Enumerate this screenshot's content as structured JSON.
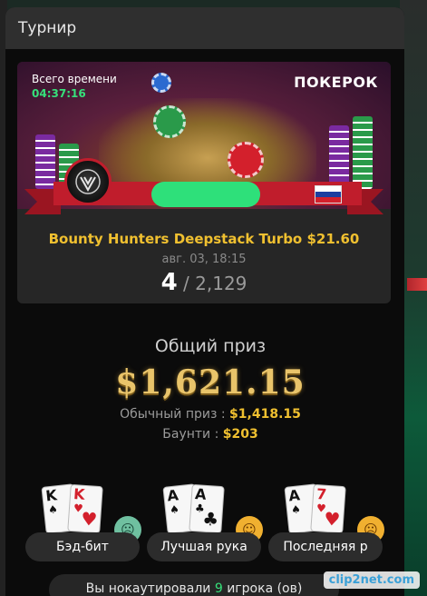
{
  "header": {
    "title": "Турнир"
  },
  "banner": {
    "elapsed_label": "Всего времени",
    "elapsed_time": "04:37:16",
    "logo": "ПОКЕРОК"
  },
  "tournament": {
    "name": "Bounty Hunters Deepstack Turbo $21.60",
    "date": "авг. 03, 18:15",
    "place": "4",
    "place_separator": " / ",
    "entrants": "2,129"
  },
  "prize": {
    "title": "Общий приз",
    "total": "$1,621.15",
    "regular_label": "Обычный приз : ",
    "regular_value": "$1,418.15",
    "bounty_label": "Баунти : ",
    "bounty_value": "$203"
  },
  "awards": [
    {
      "label": "Бэд-бит",
      "cards": [
        {
          "rank": "K",
          "suit": "♠",
          "color": "black"
        },
        {
          "rank": "K",
          "suit": "♥",
          "color": "red"
        }
      ],
      "emoji_icon": "sick-face-icon",
      "emoji_color": "#6fc0a0"
    },
    {
      "label": "Лучшая рука",
      "cards": [
        {
          "rank": "A",
          "suit": "♠",
          "color": "black"
        },
        {
          "rank": "A",
          "suit": "♣",
          "color": "black"
        }
      ],
      "emoji_icon": "thinking-face-icon",
      "emoji_color": "#f0b030"
    },
    {
      "label": "Последняя р",
      "cards": [
        {
          "rank": "A",
          "suit": "♠",
          "color": "black"
        },
        {
          "rank": "7",
          "suit": "♥",
          "color": "red"
        }
      ],
      "emoji_icon": "angry-face-icon",
      "emoji_color": "#f0b030"
    }
  ],
  "footer": {
    "prefix": "Вы нокаутировали ",
    "count": "9",
    "suffix": " игрока (ов)"
  },
  "watermark": "clip2net.com",
  "colors": {
    "accent_gold": "#f0c030",
    "accent_green": "#36e07a",
    "ribbon_red": "#c01d2c"
  }
}
